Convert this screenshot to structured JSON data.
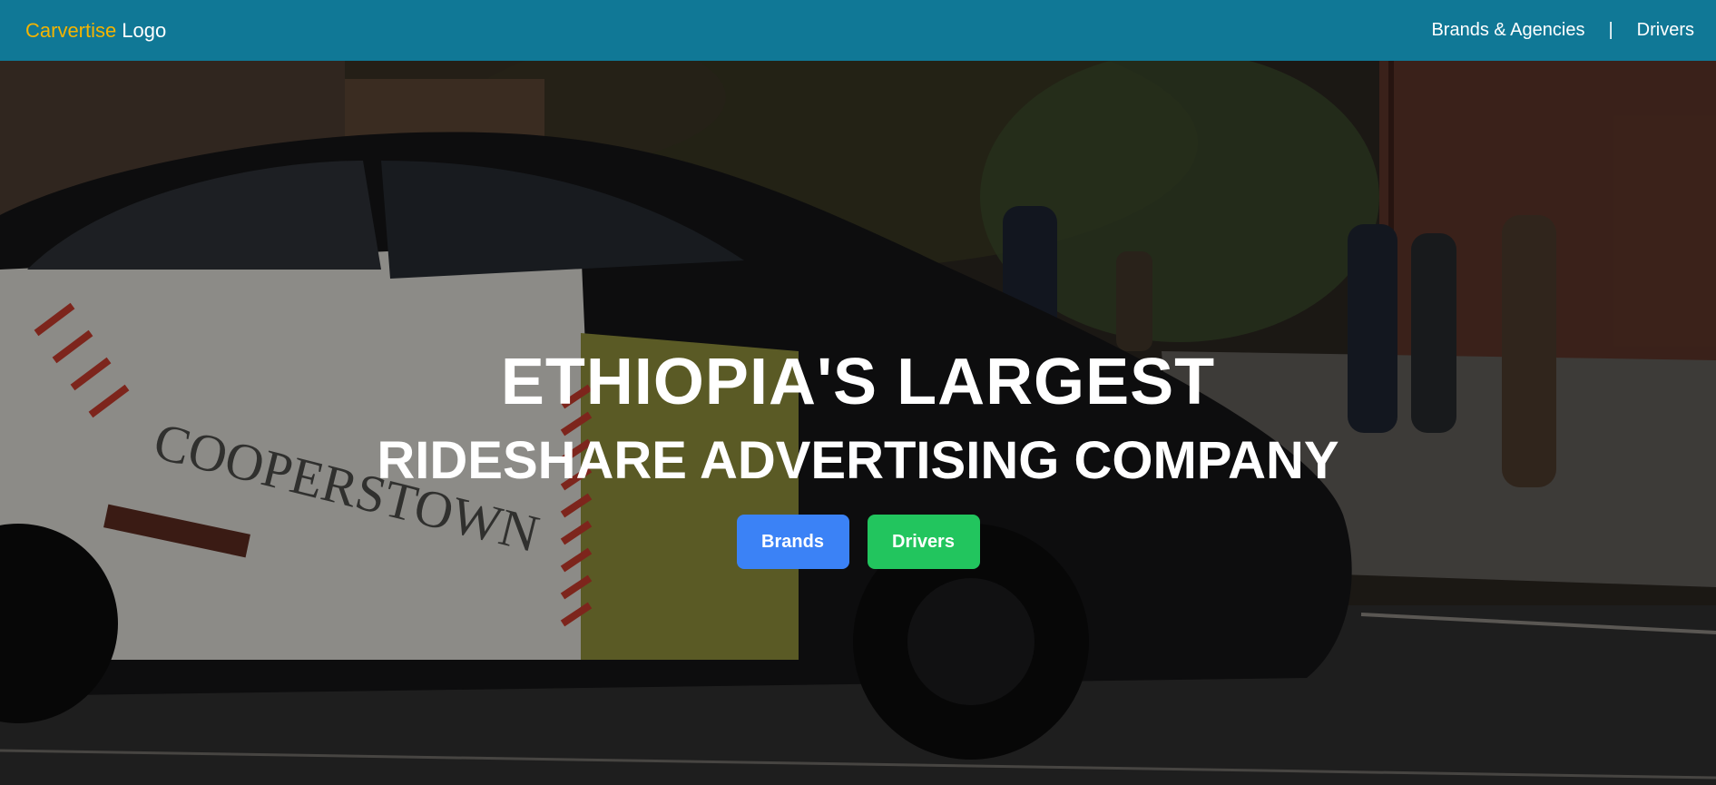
{
  "header": {
    "logo_brand": "Carvertise",
    "logo_suffix": "Logo",
    "nav": {
      "brands_agencies": "Brands & Agencies",
      "separator": "|",
      "drivers": "Drivers"
    }
  },
  "hero": {
    "headline": "ETHIOPIA'S LARGEST",
    "subheadline": "RIDESHARE ADVERTISING COMPANY",
    "buttons": {
      "brands": "Brands",
      "drivers": "Drivers"
    },
    "car_wrap_text": "COOPERSTOWN"
  },
  "colors": {
    "navbar": "#107896",
    "logo_accent": "#f4b400",
    "brands_button": "#3b82f6",
    "drivers_button": "#22c55e"
  }
}
